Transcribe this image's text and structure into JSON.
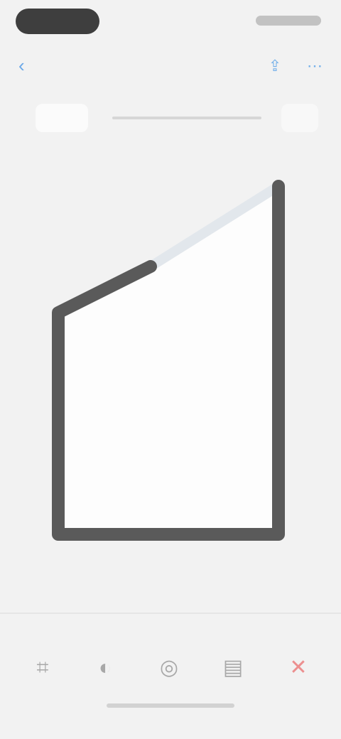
{
  "status_bar": {
    "time": ""
  },
  "nav": {
    "back_icon": "back-arrow-icon",
    "title": "",
    "actions": [
      {
        "name": "share-icon"
      },
      {
        "name": "more-icon"
      }
    ]
  },
  "editor": {
    "caption": ""
  },
  "tabbar": {
    "items": [
      {
        "name": "crop-icon",
        "label": ""
      },
      {
        "name": "adjust-icon",
        "label": ""
      },
      {
        "name": "filter-icon",
        "label": ""
      },
      {
        "name": "layers-icon",
        "label": ""
      },
      {
        "name": "delete-icon",
        "label": ""
      }
    ]
  },
  "colors": {
    "accent": "#6aa8e8",
    "frame": "#5a5a5a",
    "danger": "#ec8f8f",
    "background": "#f2f2f2"
  }
}
